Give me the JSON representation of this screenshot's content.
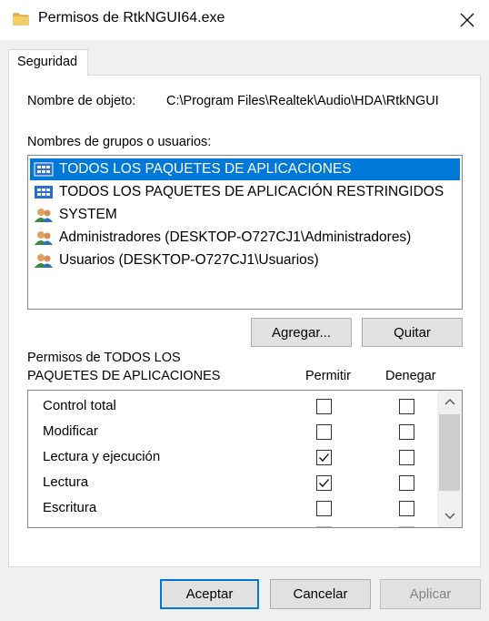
{
  "window": {
    "title": "Permisos de RtkNGUI64.exe",
    "icon": "folder-icon"
  },
  "tabs": [
    {
      "label": "Seguridad",
      "active": true
    }
  ],
  "object": {
    "label": "Nombre de objeto:",
    "value": "C:\\Program Files\\Realtek\\Audio\\HDA\\RtkNGUI"
  },
  "groups": {
    "label": "Nombres de grupos o usuarios:",
    "items": [
      {
        "name": "TODOS LOS PAQUETES DE APLICACIONES",
        "icon": "app-packages-icon",
        "selected": true
      },
      {
        "name": "TODOS LOS PAQUETES DE APLICACIÓN RESTRINGIDOS",
        "icon": "app-packages-icon",
        "selected": false
      },
      {
        "name": "SYSTEM",
        "icon": "users-group-icon",
        "selected": false
      },
      {
        "name": "Administradores (DESKTOP-O727CJ1\\Administradores)",
        "icon": "users-group-icon",
        "selected": false
      },
      {
        "name": "Usuarios (DESKTOP-O727CJ1\\Usuarios)",
        "icon": "users-group-icon",
        "selected": false
      }
    ],
    "add_button": "Agregar...",
    "remove_button": "Quitar"
  },
  "permissions": {
    "title_line1": "Permisos de TODOS LOS",
    "title_line2": "PAQUETES DE APLICACIONES",
    "allow_header": "Permitir",
    "deny_header": "Denegar",
    "rows": [
      {
        "name": "Control total",
        "allow": false,
        "deny": false
      },
      {
        "name": "Modificar",
        "allow": false,
        "deny": false
      },
      {
        "name": "Lectura y ejecución",
        "allow": true,
        "deny": false
      },
      {
        "name": "Lectura",
        "allow": true,
        "deny": false
      },
      {
        "name": "Escritura",
        "allow": false,
        "deny": false
      }
    ]
  },
  "footer": {
    "ok": "Aceptar",
    "cancel": "Cancelar",
    "apply": "Aplicar"
  },
  "colors": {
    "selection": "#0078d7",
    "window_bg": "#f0f0f0",
    "button_bg": "#e1e1e1"
  }
}
